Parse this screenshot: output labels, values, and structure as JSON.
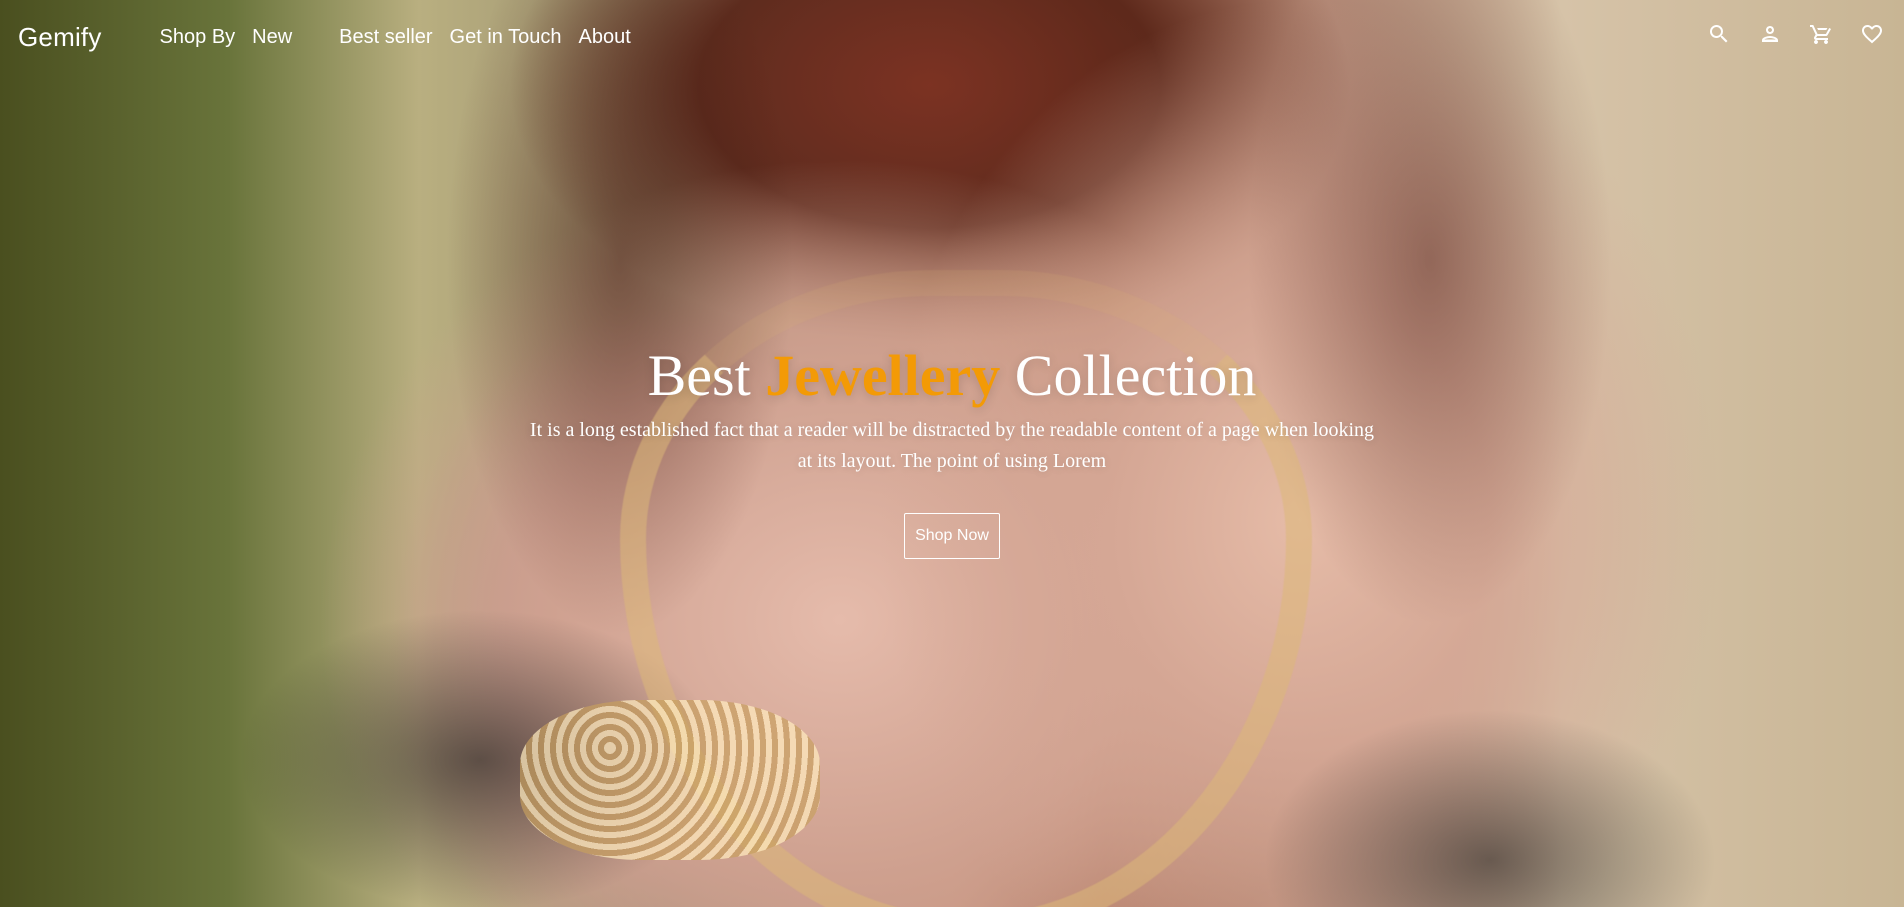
{
  "brand": {
    "name": "Gemify"
  },
  "nav": {
    "items": [
      {
        "label": "Shop By"
      },
      {
        "label": "New"
      },
      {
        "label": "Best seller"
      },
      {
        "label": "Get in Touch"
      },
      {
        "label": "About"
      }
    ]
  },
  "icons": {
    "search": "search-icon",
    "account": "user-icon",
    "cart": "cart-icon",
    "wishlist": "heart-icon"
  },
  "hero": {
    "title_part_1": "Best",
    "title_accent": "Jewellery",
    "title_part_2": "Collection",
    "description": "It is a long established fact that a reader will be distracted by the readable content of a page when looking at its layout. The point of using Lorem",
    "cta_label": "Shop Now"
  },
  "colors": {
    "text": "#ffffff",
    "accent": "#f39a06"
  }
}
